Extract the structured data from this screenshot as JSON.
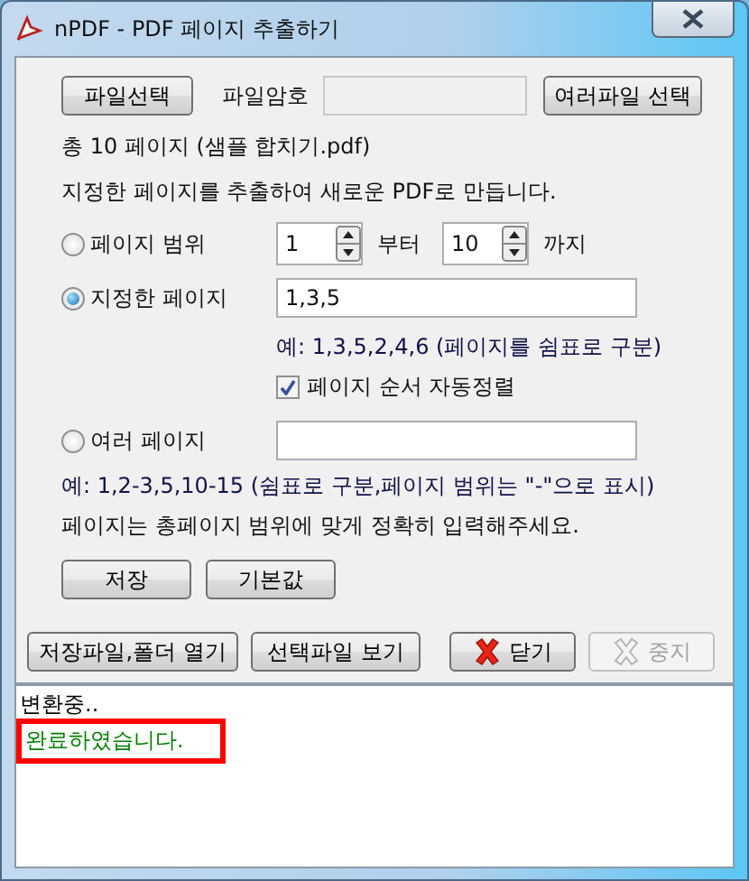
{
  "window": {
    "title": "nPDF - PDF 페이지 추출하기"
  },
  "file_row": {
    "select_button": "파일선택",
    "password_label": "파일암호",
    "multi_button": "여러파일 선택"
  },
  "page_count": "총 10 페이지 (샘플 합치기.pdf)",
  "description": "지정한 페이지를 추출하여 새로운 PDF로 만듭니다.",
  "options": [
    {
      "kind": "range",
      "label": "페이지 범위",
      "selected": false,
      "from": "1",
      "from_label": "부터",
      "to": "10",
      "to_label": "까지"
    },
    {
      "kind": "list",
      "label": "지정한 페이지",
      "selected": true,
      "value": "1,3,5",
      "hint": "예: 1,3,5,2,4,6 (페이지를 쉼표로 구분)",
      "checkbox": {
        "label": "페이지 순서 자동정렬",
        "checked": true
      }
    },
    {
      "kind": "multi",
      "label": "여러 페이지",
      "selected": false
    }
  ],
  "notes": [
    "예: 1,2-3,5,10-15 (쉼표로 구분,페이지 범위는 \"-\"으로 표시)",
    "페이지는 총페이지 범위에 맞게 정확히 입력해주세요."
  ],
  "settings_buttons": [
    "저장",
    "기본값"
  ],
  "action_buttons": [
    {
      "kind": "plain",
      "label": "저장파일,폴더 열기",
      "disabled": false
    },
    {
      "kind": "plain",
      "label": "선택파일 보기",
      "disabled": false
    },
    {
      "kind": "close",
      "label": "닫기",
      "disabled": false
    },
    {
      "kind": "stop",
      "label": "중지",
      "disabled": true
    }
  ],
  "log": [
    {
      "kind": "info",
      "text": "변환중..",
      "highlighted": false
    },
    {
      "kind": "success",
      "text": "완료하였습니다.",
      "highlighted": true
    }
  ]
}
